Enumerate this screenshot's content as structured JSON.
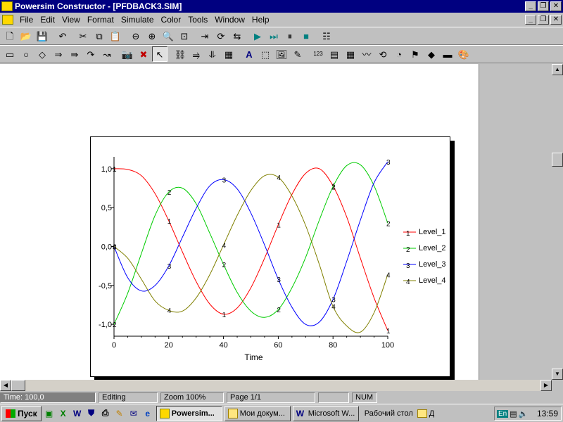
{
  "window": {
    "title": "Powersim Constructor - [PFDBACK3.SIM]"
  },
  "menu": [
    "File",
    "Edit",
    "View",
    "Format",
    "Simulate",
    "Color",
    "Tools",
    "Window",
    "Help"
  ],
  "toolbar1": [
    {
      "name": "new-icon",
      "glyph": "🗋"
    },
    {
      "name": "open-icon",
      "glyph": "📂"
    },
    {
      "name": "save-icon",
      "glyph": "💾"
    },
    {
      "name": "sep"
    },
    {
      "name": "undo-icon",
      "glyph": "↶"
    },
    {
      "name": "sep"
    },
    {
      "name": "cut-icon",
      "glyph": "✂"
    },
    {
      "name": "copy-icon",
      "glyph": "⧉"
    },
    {
      "name": "paste-icon",
      "glyph": "📋"
    },
    {
      "name": "sep"
    },
    {
      "name": "zoom-out-icon",
      "glyph": "⊖"
    },
    {
      "name": "zoom-in-icon",
      "glyph": "⊕"
    },
    {
      "name": "zoom-normal-icon",
      "glyph": "🔍"
    },
    {
      "name": "zoom-fit-icon",
      "glyph": "⊡"
    },
    {
      "name": "sep"
    },
    {
      "name": "link-back-icon",
      "glyph": "⇥"
    },
    {
      "name": "dataset-icon",
      "glyph": "⟳"
    },
    {
      "name": "loop-icon",
      "glyph": "⇆"
    },
    {
      "name": "sep"
    },
    {
      "name": "run-icon",
      "glyph": "▶"
    },
    {
      "name": "step-icon",
      "glyph": "⏭"
    },
    {
      "name": "pause-icon",
      "glyph": "⏸"
    },
    {
      "name": "stop-icon",
      "glyph": "■"
    },
    {
      "name": "sep"
    },
    {
      "name": "properties-icon",
      "glyph": "☷"
    }
  ],
  "toolbar2": [
    {
      "name": "level-icon",
      "glyph": "▭"
    },
    {
      "name": "auxiliary-icon",
      "glyph": "○"
    },
    {
      "name": "constant-icon",
      "glyph": "◇"
    },
    {
      "name": "flow-icon",
      "glyph": "⇒"
    },
    {
      "name": "flow-with-rate-icon",
      "glyph": "⇛"
    },
    {
      "name": "link-icon",
      "glyph": "↷"
    },
    {
      "name": "delayed-link-icon",
      "glyph": "↝"
    },
    {
      "name": "sep"
    },
    {
      "name": "snapshot-icon",
      "glyph": "📷"
    },
    {
      "name": "delete-icon",
      "glyph": "✖"
    },
    {
      "name": "pointer-icon",
      "glyph": "↖"
    },
    {
      "name": "sep"
    },
    {
      "name": "chain-icon",
      "glyph": "⛓"
    },
    {
      "name": "flow-chain-icon",
      "glyph": "⥤"
    },
    {
      "name": "array-icon",
      "glyph": "⥥"
    },
    {
      "name": "layers-icon",
      "glyph": "▦"
    },
    {
      "name": "sep"
    },
    {
      "name": "text-icon",
      "glyph": "A"
    },
    {
      "name": "frame-icon",
      "glyph": "⬚"
    },
    {
      "name": "picture-icon",
      "glyph": "🖼"
    },
    {
      "name": "probe-icon",
      "glyph": "✎"
    },
    {
      "name": "sep"
    },
    {
      "name": "number-icon",
      "glyph": "123"
    },
    {
      "name": "slider-icon",
      "glyph": "▤"
    },
    {
      "name": "table-icon",
      "glyph": "▦"
    },
    {
      "name": "time-graph-icon",
      "glyph": "〰"
    },
    {
      "name": "xy-graph-icon",
      "glyph": "⟲"
    },
    {
      "name": "gauge-icon",
      "glyph": "◔"
    },
    {
      "name": "switch-icon",
      "glyph": "⚑"
    },
    {
      "name": "diamond-icon",
      "glyph": "◆"
    },
    {
      "name": "button-icon",
      "glyph": "▬"
    },
    {
      "name": "palette-icon",
      "glyph": "🎨"
    }
  ],
  "status": {
    "time": "Time: 100,0",
    "mode": "Editing",
    "zoom": "Zoom 100%",
    "page": "Page  1/1",
    "num": "NUM"
  },
  "taskbar": {
    "start": "Пуск",
    "tasks": [
      "Powersim...",
      "Мои докум...",
      "Microsoft W..."
    ],
    "desktop": "Рабочий стол",
    "folder": "Д",
    "lang": "En",
    "clock": "13:59"
  },
  "colors": {
    "level1": "#ff0000",
    "level2": "#00cc00",
    "level3": "#0000ff",
    "level4": "#808000"
  },
  "chart_data": {
    "type": "line",
    "xlabel": "Time",
    "xlim": [
      0,
      100
    ],
    "ylim": [
      -1.0,
      1.0
    ],
    "x_ticks": [
      "0",
      "20",
      "40",
      "60",
      "80",
      "100"
    ],
    "y_ticks": [
      "1,0",
      "0,5",
      "0,0",
      "-0,5",
      "-1,0"
    ],
    "x": [
      0,
      5,
      10,
      15,
      20,
      25,
      30,
      35,
      40,
      45,
      50,
      55,
      60,
      65,
      70,
      75,
      80,
      85,
      90,
      95,
      100
    ],
    "series": [
      {
        "name": "Level_1",
        "marker": "1",
        "color": "#ff0000",
        "values": [
          1.0,
          0.99,
          0.91,
          0.68,
          0.33,
          -0.07,
          -0.45,
          -0.74,
          -0.87,
          -0.79,
          -0.53,
          -0.15,
          0.28,
          0.67,
          0.94,
          1.0,
          0.78,
          0.38,
          -0.15,
          -0.66,
          -1.08
        ]
      },
      {
        "name": "Level_2",
        "marker": "2",
        "color": "#00cc00",
        "values": [
          -1.0,
          -0.6,
          -0.09,
          0.4,
          0.7,
          0.75,
          0.55,
          0.17,
          -0.23,
          -0.59,
          -0.83,
          -0.91,
          -0.81,
          -0.53,
          -0.14,
          0.34,
          0.77,
          1.04,
          1.05,
          0.78,
          0.3
        ]
      },
      {
        "name": "Level_3",
        "marker": "3",
        "color": "#0000ff",
        "values": [
          0.0,
          -0.4,
          -0.57,
          -0.5,
          -0.25,
          0.12,
          0.49,
          0.78,
          0.86,
          0.74,
          0.43,
          0.02,
          -0.42,
          -0.78,
          -1.0,
          -0.97,
          -0.68,
          -0.19,
          0.34,
          0.82,
          1.09
        ]
      },
      {
        "name": "Level_4",
        "marker": "4",
        "color": "#808000",
        "values": [
          0.0,
          -0.15,
          -0.42,
          -0.7,
          -0.82,
          -0.83,
          -0.66,
          -0.36,
          0.02,
          0.4,
          0.72,
          0.91,
          0.89,
          0.65,
          0.27,
          -0.23,
          -0.77,
          -1.02,
          -1.1,
          -0.85,
          -0.36
        ]
      }
    ],
    "legend": "right"
  }
}
